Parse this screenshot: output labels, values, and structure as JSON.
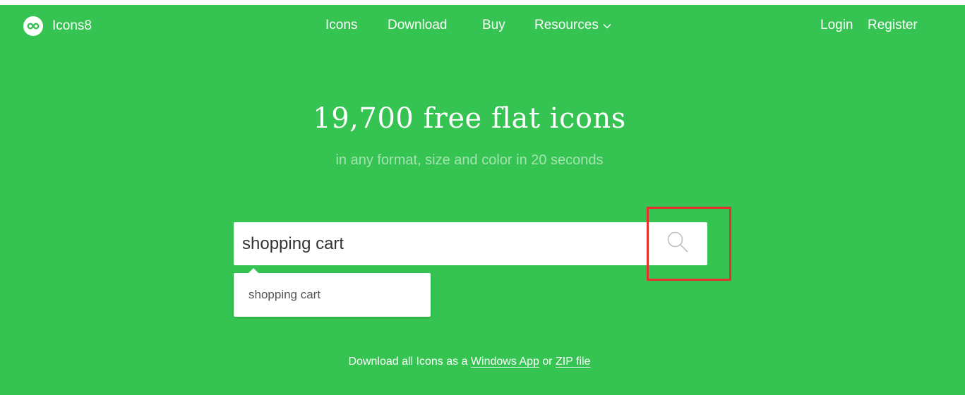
{
  "brand": {
    "name": "Icons8",
    "logo_icon": "infinity-logo-icon",
    "accent_color": "#35c352",
    "highlight_color": "#e5302e"
  },
  "nav": {
    "items": [
      {
        "label": "Icons"
      },
      {
        "label": "Download"
      },
      {
        "label": "Buy"
      },
      {
        "label": "Resources",
        "icon": "chevron-down-icon"
      }
    ],
    "login": "Login",
    "register": "Register"
  },
  "hero": {
    "title": "19,700 free flat icons",
    "subtitle": "in any format, size and color in 20 seconds"
  },
  "search": {
    "value": "shopping cart",
    "button_icon": "search-icon",
    "suggestions": [
      "shopping cart"
    ]
  },
  "download": {
    "prefix": "Download all Icons as a",
    "windows_app": "Windows App",
    "or": "or",
    "zip_file": "ZIP file"
  }
}
